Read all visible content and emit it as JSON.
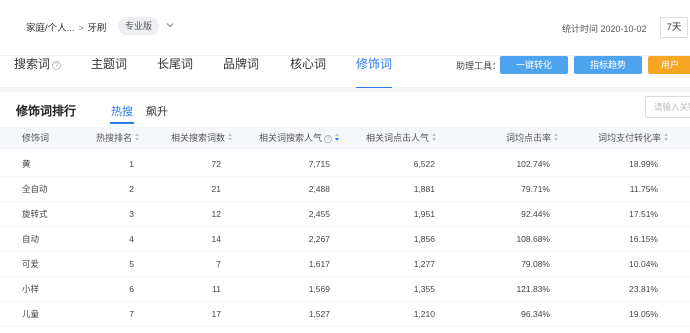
{
  "header": {
    "breadcrumb": [
      "家庭/个人...",
      "牙刷"
    ],
    "breadcrumb_sep": ">",
    "badge": "专业版",
    "stat_time": "统计时间 2020-10-02",
    "range": "7天"
  },
  "tabs": [
    {
      "label": "搜索词",
      "help": "?"
    },
    {
      "label": "主题词"
    },
    {
      "label": "长尾词"
    },
    {
      "label": "品牌词"
    },
    {
      "label": "核心词"
    },
    {
      "label": "修饰词",
      "active": true
    }
  ],
  "tools": {
    "label": "助理工具：",
    "buttons": [
      {
        "label": "一键转化",
        "color": "#4ea3ee"
      },
      {
        "label": "指标趋势",
        "color": "#4ea3ee"
      },
      {
        "label": "用户",
        "color": "#f5a623"
      }
    ]
  },
  "section": {
    "title": "修饰词排行",
    "subtabs": [
      "热搜",
      "飙升"
    ],
    "active_subtab": 0,
    "search_placeholder": "请输入关键词"
  },
  "colors": {
    "accent": "#2b7bea",
    "tool_blue": "#4ea3ee",
    "tool_orange": "#f5a623",
    "header_bg": "#f5f7fa"
  },
  "table": {
    "headers": [
      "修饰词",
      "热搜排名",
      "相关搜索词数",
      "相关词搜索人气",
      "相关词点击人气",
      "词均点击率",
      "词均支付转化率"
    ],
    "rows": [
      [
        "黄",
        "1",
        "72",
        "7,715",
        "6,522",
        "102.74%",
        "18.99%"
      ],
      [
        "全自动",
        "2",
        "21",
        "2,488",
        "1,881",
        "79.71%",
        "11.75%"
      ],
      [
        "旋转式",
        "3",
        "12",
        "2,455",
        "1,951",
        "92.44%",
        "17.51%"
      ],
      [
        "自动",
        "4",
        "14",
        "2,267",
        "1,856",
        "108.68%",
        "16.15%"
      ],
      [
        "可爱",
        "5",
        "7",
        "1,617",
        "1,277",
        "79.08%",
        "10.04%"
      ],
      [
        "小样",
        "6",
        "11",
        "1,569",
        "1,355",
        "121.83%",
        "23.81%"
      ],
      [
        "儿童",
        "7",
        "17",
        "1,527",
        "1,210",
        "96.34%",
        "19.05%"
      ]
    ]
  }
}
